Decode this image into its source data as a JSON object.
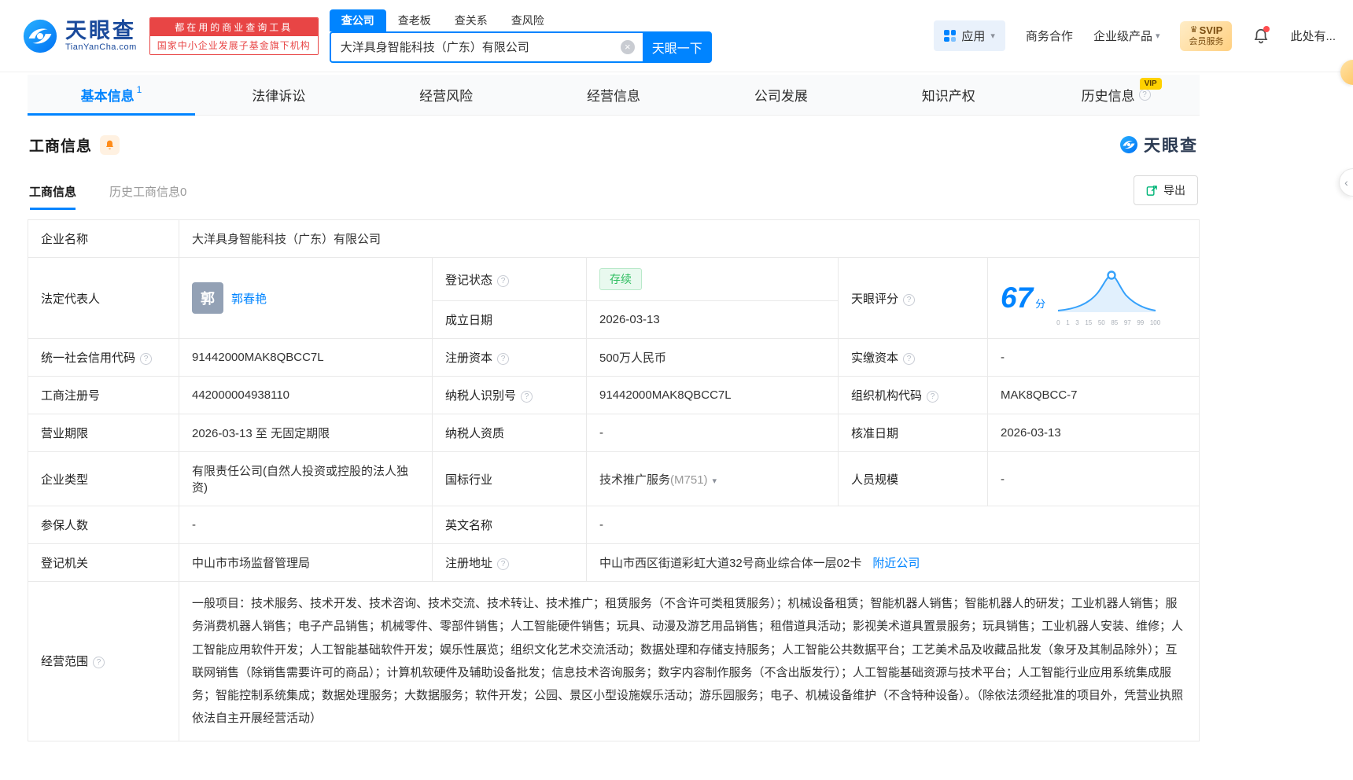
{
  "brand": {
    "name": "天眼查",
    "domain": "TianYanCha.com",
    "primary_color": "#0084ff"
  },
  "icons": {
    "help": "?",
    "clear": "×",
    "caret_down": "▾",
    "collapse_left": "‹",
    "crown": "♛"
  },
  "header": {
    "promo_line1": "都在用的商业查询工具",
    "promo_line2": "国家中小企业发展子基金旗下机构",
    "search": {
      "tabs": [
        "查公司",
        "查老板",
        "查关系",
        "查风险"
      ],
      "value": "大洋具身智能科技（广东）有限公司",
      "button": "天眼一下"
    },
    "nav": {
      "apps": "应用",
      "cooperation": "商务合作",
      "enterprise": "企业级产品",
      "svip_line1": "SVIP",
      "svip_line2": "会员服务",
      "user": "此处有..."
    }
  },
  "main_tabs": [
    {
      "label": "基本信息",
      "badge": "1"
    },
    {
      "label": "法律诉讼"
    },
    {
      "label": "经营风险"
    },
    {
      "label": "经营信息"
    },
    {
      "label": "公司发展"
    },
    {
      "label": "知识产权"
    },
    {
      "label": "历史信息",
      "vip": "VIP"
    }
  ],
  "section": {
    "title": "工商信息",
    "subtab_current": "工商信息",
    "subtab_history": "历史工商信息0",
    "export": "导出",
    "watermark": "天眼查"
  },
  "fields": {
    "company_name": {
      "label": "企业名称",
      "value": "大洋具身智能科技（广东）有限公司"
    },
    "legal_rep": {
      "label": "法定代表人",
      "avatar": "郭",
      "value": "郭春艳"
    },
    "reg_status": {
      "label": "登记状态",
      "value": "存续"
    },
    "score": {
      "label": "天眼评分",
      "value": "67",
      "unit": "分"
    },
    "established_date": {
      "label": "成立日期",
      "value": "2026-03-13"
    },
    "credit_code": {
      "label": "统一社会信用代码",
      "value": "91442000MAK8QBCC7L"
    },
    "registered_capital": {
      "label": "注册资本",
      "value": "500万人民币"
    },
    "paid_in_capital": {
      "label": "实缴资本",
      "value": "-"
    },
    "reg_number": {
      "label": "工商注册号",
      "value": "442000004938110"
    },
    "taxpayer_id": {
      "label": "纳税人识别号",
      "value": "91442000MAK8QBCC7L"
    },
    "org_code": {
      "label": "组织机构代码",
      "value": "MAK8QBCC-7"
    },
    "business_term": {
      "label": "营业期限",
      "value": "2026-03-13 至 无固定期限"
    },
    "taxpayer_qualification": {
      "label": "纳税人资质",
      "value": "-"
    },
    "approval_date": {
      "label": "核准日期",
      "value": "2026-03-13"
    },
    "company_type": {
      "label": "企业类型",
      "value": "有限责任公司(自然人投资或控股的法人独资)"
    },
    "industry": {
      "label": "国标行业",
      "value": "技术推广服务",
      "code": "(M751)"
    },
    "staff_size": {
      "label": "人员规模",
      "value": "-"
    },
    "insured_count": {
      "label": "参保人数",
      "value": "-"
    },
    "english_name": {
      "label": "英文名称",
      "value": "-"
    },
    "registration_authority": {
      "label": "登记机关",
      "value": "中山市市场监督管理局"
    },
    "registered_address": {
      "label": "注册地址",
      "value": "中山市西区街道彩虹大道32号商业综合体一层02卡",
      "link": "附近公司"
    },
    "business_scope": {
      "label": "经营范围",
      "value": "一般项目：技术服务、技术开发、技术咨询、技术交流、技术转让、技术推广；租赁服务（不含许可类租赁服务）；机械设备租赁；智能机器人销售；智能机器人的研发；工业机器人销售；服务消费机器人销售；电子产品销售；机械零件、零部件销售；人工智能硬件销售；玩具、动漫及游艺用品销售；租借道具活动；影视美术道具置景服务；玩具销售；工业机器人安装、维修；人工智能应用软件开发；人工智能基础软件开发；娱乐性展览；组织文化艺术交流活动；数据处理和存储支持服务；人工智能公共数据平台；工艺美术品及收藏品批发（象牙及其制品除外）；互联网销售（除销售需要许可的商品）；计算机软硬件及辅助设备批发；信息技术咨询服务；数字内容制作服务（不含出版发行）；人工智能基础资源与技术平台；人工智能行业应用系统集成服务；智能控制系统集成；数据处理服务；大数据服务；软件开发；公园、景区小型设施娱乐活动；游乐园服务；电子、机械设备维护（不含特种设备）。（除依法须经批准的项目外，凭营业执照依法自主开展经营活动）"
    }
  },
  "score_chart": {
    "type": "area",
    "score": 67,
    "ticks": [
      "0",
      "1",
      "3",
      "15",
      "50",
      "85",
      "97",
      "99",
      "100"
    ]
  }
}
